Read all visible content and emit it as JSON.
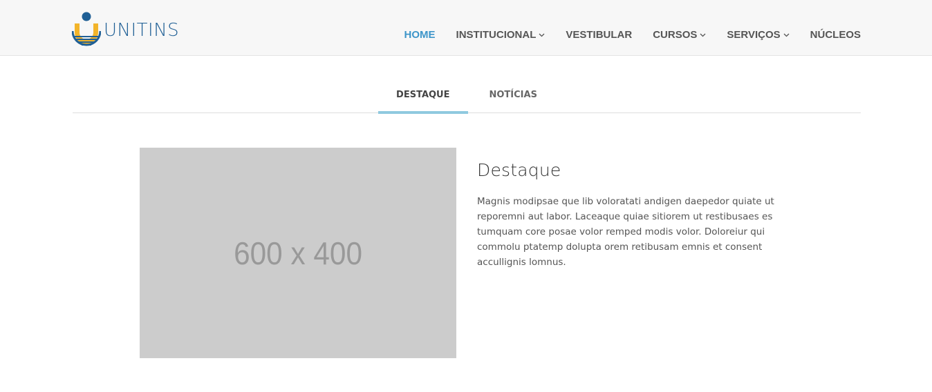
{
  "header": {
    "logo_text": "UNITINS",
    "logo_icon": "unitins-logo-icon",
    "nav": [
      {
        "label": "HOME",
        "active": true,
        "dropdown": false
      },
      {
        "label": "INSTITUCIONAL",
        "active": false,
        "dropdown": true
      },
      {
        "label": "VESTIBULAR",
        "active": false,
        "dropdown": false
      },
      {
        "label": "CURSOS",
        "active": false,
        "dropdown": true
      },
      {
        "label": "SERVIÇOS",
        "active": false,
        "dropdown": true
      },
      {
        "label": "NÚCLEOS",
        "active": false,
        "dropdown": false
      }
    ],
    "active_color": "#3d95c9"
  },
  "tabs": [
    {
      "label": "DESTAQUE",
      "active": true
    },
    {
      "label": "NOTÍCIAS",
      "active": false
    }
  ],
  "feature": {
    "image_placeholder": "600 x 400",
    "title": "Destaque",
    "body": "Magnis modipsae que lib voloratati andigen daepedor quiate ut reporemni aut labor. Laceaque quiae sitiorem ut restibusaes es tumquam core posae volor remped modis volor. Doloreiur qui commolu ptatemp dolupta orem retibusam emnis et consent accullignis lomnus."
  },
  "colors": {
    "tab_indicator": "#8fc9df",
    "logo_blue": "#1f5f95",
    "logo_yellow": "#f2b42a"
  }
}
